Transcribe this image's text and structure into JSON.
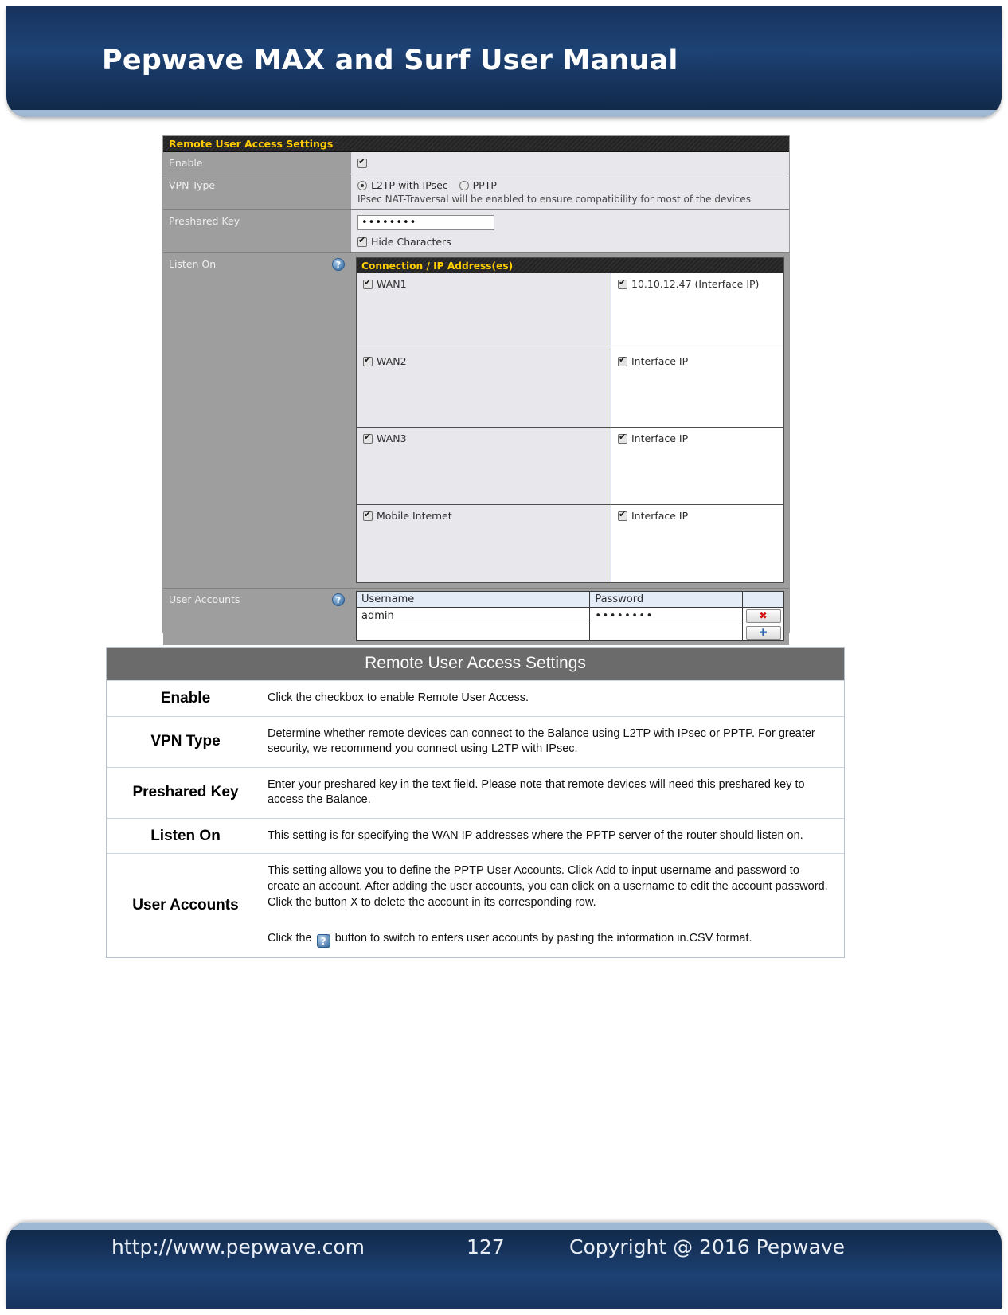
{
  "header": {
    "title": "Pepwave MAX and Surf User Manual"
  },
  "footer": {
    "url": "http://www.pepwave.com",
    "page": "127",
    "copyright": "Copyright @ 2016 Pepwave"
  },
  "screenshot": {
    "panel_title": "Remote User Access Settings",
    "rows": {
      "enable": {
        "label": "Enable",
        "checked": true
      },
      "vpn_type": {
        "label": "VPN Type",
        "options": [
          {
            "label": "L2TP with IPsec",
            "selected": true
          },
          {
            "label": "PPTP",
            "selected": false
          }
        ],
        "hint": "IPsec NAT-Traversal will be enabled to ensure compatibility for most of the devices"
      },
      "preshared_key": {
        "label": "Preshared Key",
        "value": "••••••••",
        "hide_characters_label": "Hide Characters",
        "hide_characters_checked": true
      },
      "listen_on": {
        "label": "Listen On",
        "help_icon": "question-mark-icon",
        "table_title": "Connection / IP Address(es)",
        "connections": [
          {
            "name": "WAN1",
            "checked": true,
            "ip_label": "10.10.12.47 (Interface IP)",
            "ip_checked": true
          },
          {
            "name": "WAN2",
            "checked": true,
            "ip_label": "Interface IP",
            "ip_checked": true
          },
          {
            "name": "WAN3",
            "checked": true,
            "ip_label": "Interface IP",
            "ip_checked": true
          },
          {
            "name": "Mobile Internet",
            "checked": true,
            "ip_label": "Interface IP",
            "ip_checked": true
          }
        ]
      },
      "user_accounts": {
        "label": "User Accounts",
        "help_icon": "question-mark-icon",
        "columns": [
          "Username",
          "Password"
        ],
        "accounts": [
          {
            "username": "admin",
            "password": "••••••••",
            "action": "✖"
          },
          {
            "username": "",
            "password": "",
            "action": "✚"
          }
        ]
      }
    }
  },
  "description": {
    "title": "Remote User Access Settings",
    "rows": [
      {
        "key": "Enable",
        "text": "Click the checkbox to enable Remote User Access."
      },
      {
        "key": "VPN Type",
        "text": "Determine whether remote devices can connect to the Balance using L2TP with IPsec or PPTP. For greater security, we recommend you connect using L2TP with IPsec."
      },
      {
        "key": "Preshared Key",
        "text": "Enter your preshared key in the text field. Please note that remote devices will need this preshared key to access the Balance."
      },
      {
        "key": "Listen On",
        "text": "This setting is for specifying the WAN IP addresses where the PPTP server of the router should listen on."
      },
      {
        "key": "User Accounts",
        "text": "This setting allows you to define the PPTP User Accounts. Click Add to input username and password to create an account. After adding the user accounts, you can click on a username to edit the account password. Click the button X to delete the account in its corresponding row.",
        "text2_before": "Click the",
        "text2_icon": "question-mark-icon",
        "text2_after": "button to switch to enters user accounts by pasting the information in.CSV format."
      }
    ]
  }
}
